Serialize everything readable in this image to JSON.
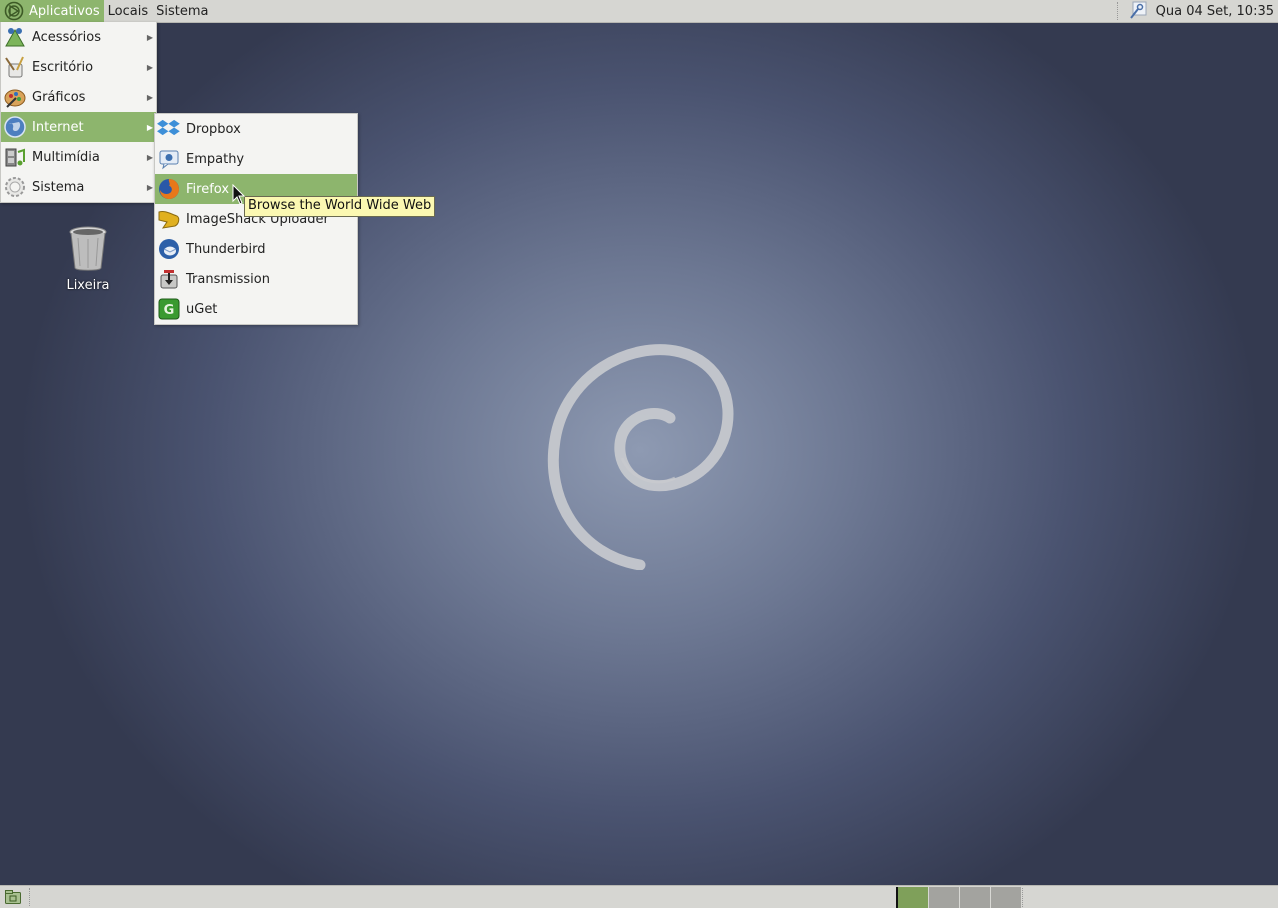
{
  "top_panel": {
    "menus": [
      {
        "label": "Aplicativos",
        "active": true
      },
      {
        "label": "Locais",
        "active": false
      },
      {
        "label": "Sistema",
        "active": false
      }
    ],
    "clock": "Qua 04 Set, 10:35",
    "tray_icon": "network-key-icon"
  },
  "applications_menu": {
    "items": [
      {
        "label": "Acessórios",
        "icon": "accessories-icon"
      },
      {
        "label": "Escritório",
        "icon": "office-icon"
      },
      {
        "label": "Gráficos",
        "icon": "graphics-icon"
      },
      {
        "label": "Internet",
        "icon": "internet-globe-icon",
        "active": true
      },
      {
        "label": "Multimídia",
        "icon": "multimedia-icon"
      },
      {
        "label": "Sistema",
        "icon": "system-gear-icon"
      }
    ]
  },
  "internet_submenu": {
    "items": [
      {
        "label": "Dropbox",
        "icon": "dropbox-icon"
      },
      {
        "label": "Empathy",
        "icon": "empathy-icon"
      },
      {
        "label": "Firefox",
        "icon": "firefox-icon",
        "active": true
      },
      {
        "label": "ImageShack Uploader",
        "icon": "imageshack-icon"
      },
      {
        "label": "Thunderbird",
        "icon": "thunderbird-icon"
      },
      {
        "label": "Transmission",
        "icon": "transmission-icon"
      },
      {
        "label": "uGet",
        "icon": "uget-icon"
      }
    ]
  },
  "tooltip": "Browse the World Wide Web",
  "desktop": {
    "icons": [
      {
        "label": "Lixeira",
        "icon": "trash-icon"
      }
    ]
  },
  "bottom_panel": {
    "workspaces": [
      {
        "active": true
      },
      {
        "active": false
      },
      {
        "active": false
      },
      {
        "active": false
      }
    ]
  },
  "colors": {
    "accent": "#8db56d",
    "panel": "#d6d6d2",
    "tooltip_bg": "#fbf8b2"
  }
}
